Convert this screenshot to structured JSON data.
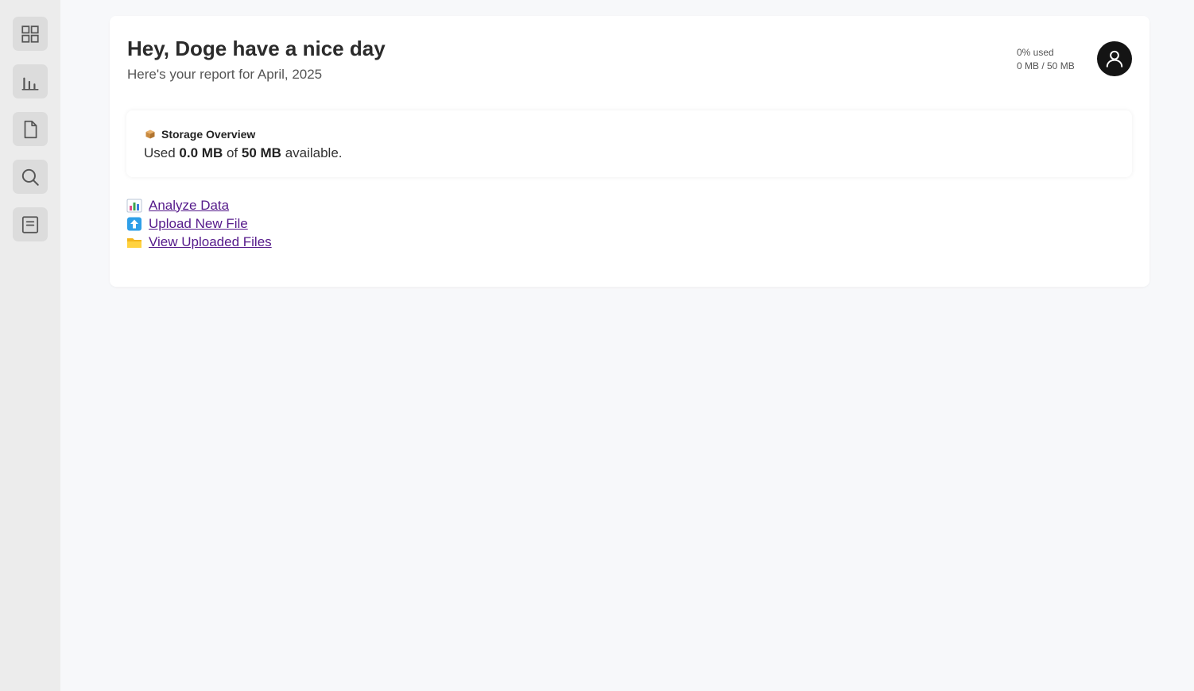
{
  "sidebar": {
    "items": [
      {
        "icon": "dashboard-grid-icon"
      },
      {
        "icon": "bar-chart-icon"
      },
      {
        "icon": "document-icon"
      },
      {
        "icon": "search-icon"
      },
      {
        "icon": "notes-icon"
      }
    ]
  },
  "header": {
    "greeting": "Hey, Doge have a nice day",
    "subtitle": "Here's your report for April, 2025",
    "usage_percent": "0% used",
    "usage_amount": "0 MB / 50 MB",
    "avatar_icon": "user-icon"
  },
  "storage": {
    "title": "Storage Overview",
    "icon": "package-icon",
    "text_prefix": "Used",
    "used": "0.0 MB",
    "text_mid": "of",
    "total": "50 MB",
    "text_suffix": "available."
  },
  "links": {
    "analyze": {
      "label": "Analyze Data",
      "icon": "bar-chart-emoji-icon"
    },
    "upload": {
      "label": "Upload New File",
      "icon": "up-arrow-emoji-icon"
    },
    "files": {
      "label": "View Uploaded Files",
      "icon": "folder-emoji-icon"
    }
  },
  "colors": {
    "link": "#551a8b",
    "avatar_bg": "#141414",
    "sidebar_bg": "#ececec",
    "page_bg": "#f7f8fa"
  }
}
